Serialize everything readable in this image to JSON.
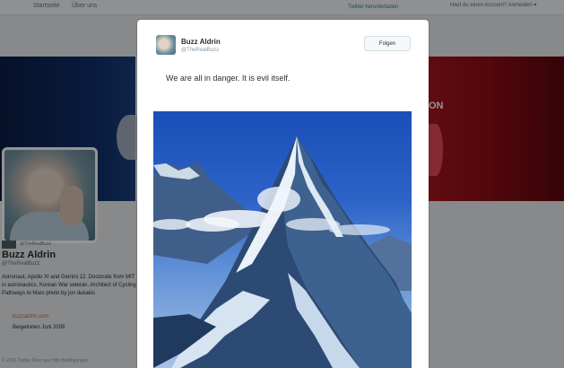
{
  "topbar": {
    "nav_a": "Startseite",
    "nav_b": "Über uns",
    "nav_c": "Twitter herunterladen",
    "nav_d": "Hast du einen Account? Anmelden ▾"
  },
  "banner": {
    "text": "ON"
  },
  "profile": {
    "handle_top": "@TheRealBuzz",
    "name": "Buzz Aldrin",
    "handle": "@TheRealBuzz",
    "bio": "Astronaut, Apollo XI and Gemini 12. Doctorate from MIT in astronautics. Korean War veteran. Architect of Cycling Pathways to Mars photo by jon dukakis",
    "link": "buzzaldrin.com",
    "joined": "Beigetreten Juni 2009"
  },
  "footer": {
    "text": "© 2016 Twitter   Über uns   Hilfe   Bedingungen"
  },
  "modal": {
    "name": "Buzz Aldrin",
    "handle": "@TheRealBuzz",
    "follow_label": "Folgen",
    "tweet_text": "We are all in danger. It is evil itself."
  },
  "colors": {
    "accent": "#2e8c8f",
    "link": "#d96b3f",
    "sky": "#2d63c7"
  }
}
